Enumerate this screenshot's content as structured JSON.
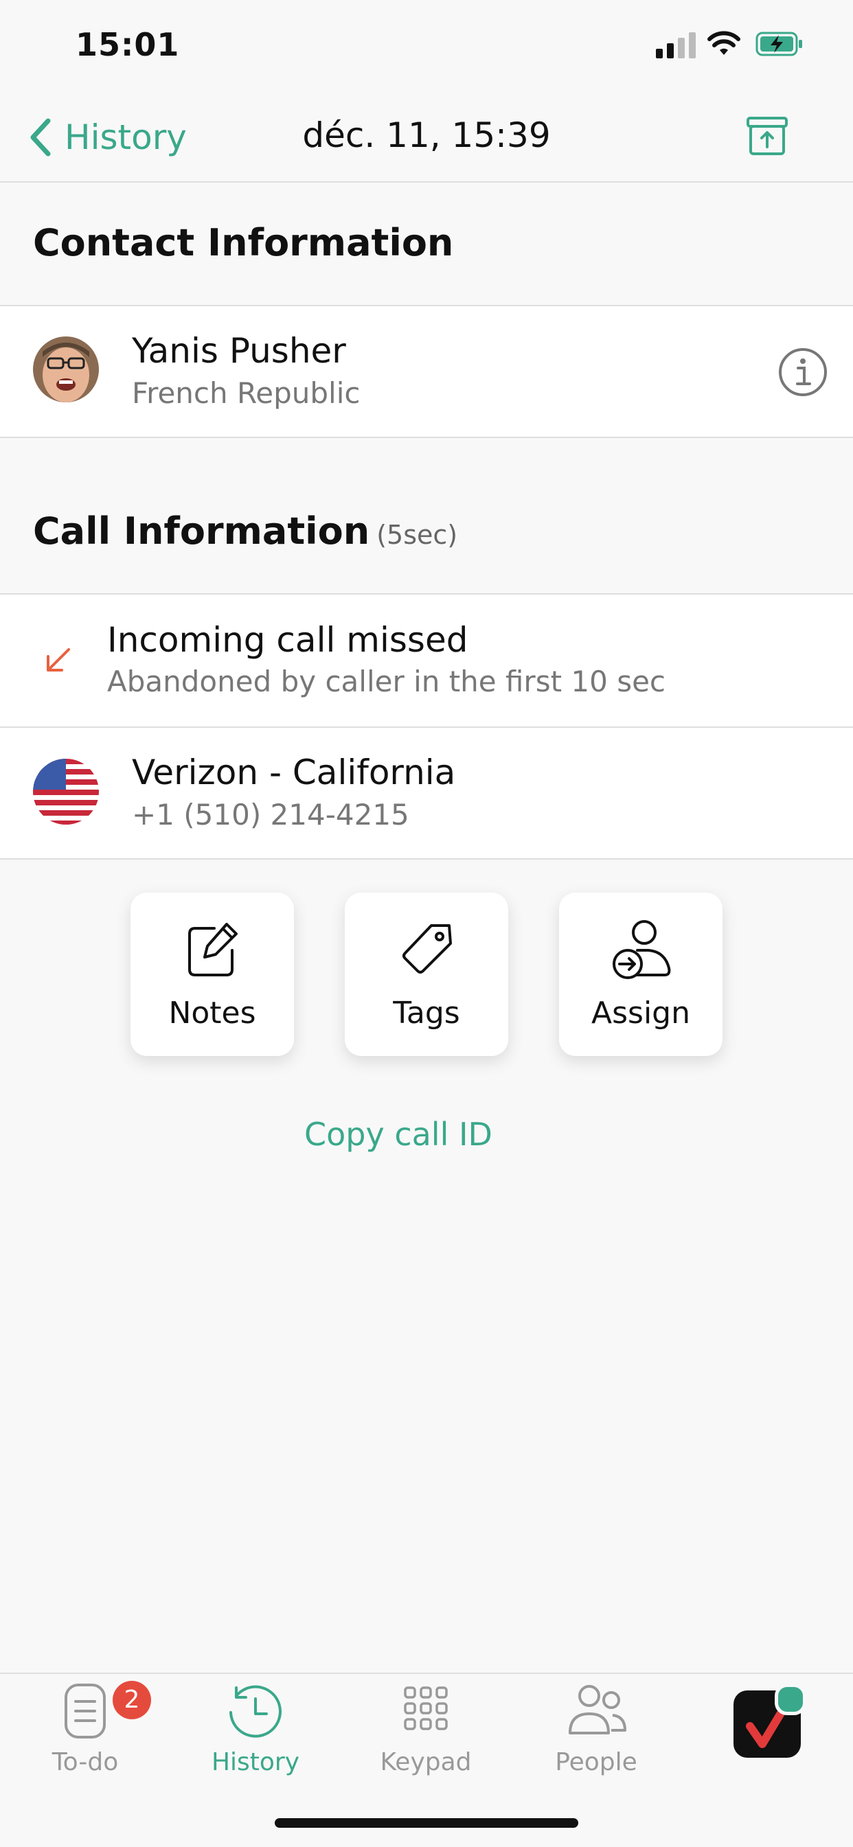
{
  "status_bar": {
    "time": "15:01"
  },
  "nav": {
    "back_label": "History",
    "title": "déc. 11, 15:39"
  },
  "contact_section": {
    "title": "Contact Information",
    "contact": {
      "name": "Yanis Pusher",
      "subtitle": "French Republic"
    }
  },
  "call_section": {
    "title": "Call Information",
    "duration": "(5sec)",
    "status": {
      "title": "Incoming call missed",
      "detail": "Abandoned by caller in the first 10 sec"
    },
    "line": {
      "name": "Verizon - California",
      "number": "+1 (510) 214-4215"
    }
  },
  "actions": [
    {
      "label": "Notes",
      "icon": "notes-icon"
    },
    {
      "label": "Tags",
      "icon": "tag-icon"
    },
    {
      "label": "Assign",
      "icon": "assign-icon"
    }
  ],
  "copy_call_id_label": "Copy call ID",
  "tabs": [
    {
      "label": "To-do",
      "badge": "2",
      "icon": "todo-icon"
    },
    {
      "label": "History",
      "icon": "history-icon",
      "active": true
    },
    {
      "label": "Keypad",
      "icon": "keypad-icon"
    },
    {
      "label": "People",
      "icon": "people-icon"
    }
  ],
  "colors": {
    "accent": "#3aa88a",
    "missed": "#e8613f",
    "badge": "#e54b3c"
  }
}
